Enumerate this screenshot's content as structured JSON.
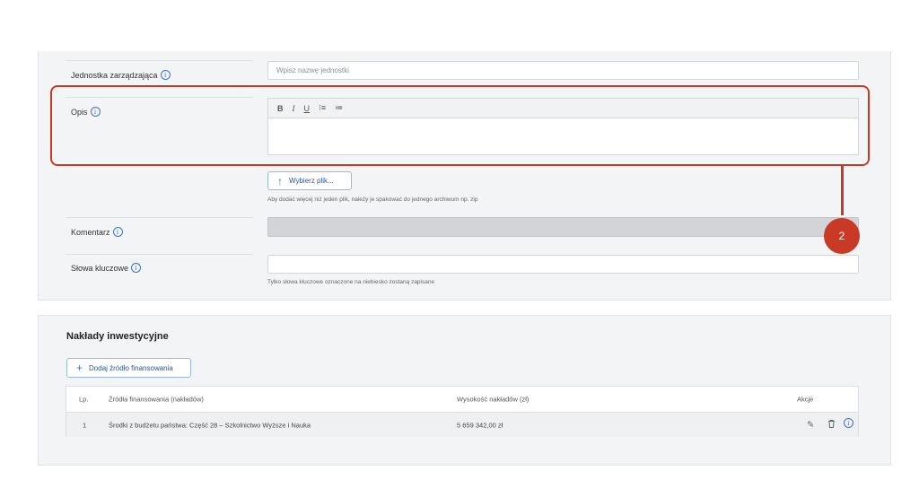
{
  "fields": {
    "unit": {
      "label": "Jednostka zarządzająca",
      "placeholder": "Wpisz nazwę jednostki"
    },
    "description": {
      "label": "Opis",
      "toolbar": [
        "B",
        "I",
        "U",
        "⁝≡",
        "≔"
      ]
    },
    "upload": {
      "button_label": "Wybierz plik...",
      "hint": "Aby dodać więcej niż jeden plik, należy je spakować do jednego archiwum np. zip"
    },
    "comment": {
      "label": "Komentarz"
    },
    "keywords": {
      "label": "Słowa kluczowe",
      "hint": "Tylko słowa kluczowe oznaczone na niebiesko zostaną zapisane"
    }
  },
  "info_glyph": "i",
  "callout": {
    "number": "2",
    "color": "#c83a25"
  },
  "investment": {
    "title": "Nakłady inwestycyjne",
    "add_button": "Dodaj źródło finansowania",
    "table": {
      "columns": [
        "Lp.",
        "Źródła finansowania (nakładów)",
        "Wysokość nakładów (zł)",
        "Akcje"
      ],
      "rows": [
        {
          "lp": "1",
          "source": "Środki z budżetu państwa: Część 28 – Szkolnictwo Wyższe i Nauka",
          "amount": "5 659 342,00 zł"
        }
      ]
    }
  },
  "icons": {
    "upload": "arrow-up-icon",
    "add": "plus-icon",
    "edit": "pencil-icon",
    "delete": "trash-icon",
    "info": "info-icon"
  }
}
